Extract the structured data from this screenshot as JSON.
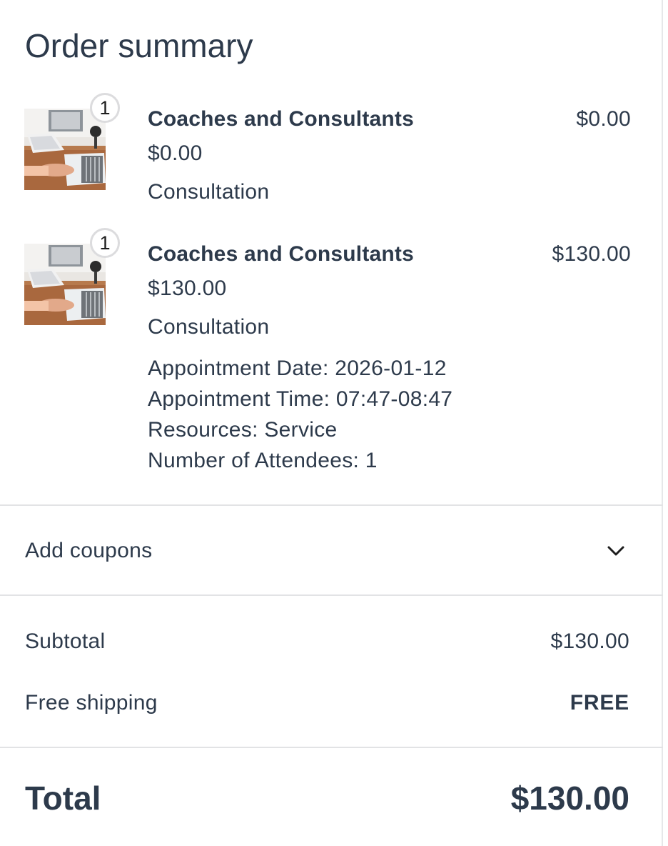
{
  "order_summary": {
    "title": "Order summary",
    "items": [
      {
        "quantity": "1",
        "name": "Coaches and Consultants",
        "unit_price": "$0.00",
        "description": "Consultation",
        "line_price": "$0.00",
        "meta": []
      },
      {
        "quantity": "1",
        "name": "Coaches and Consultants",
        "unit_price": "$130.00",
        "description": "Consultation",
        "line_price": "$130.00",
        "meta": [
          "Appointment Date: 2026-01-12",
          "Appointment Time: 07:47-08:47",
          "Resources: Service",
          "Number of Attendees: 1"
        ]
      }
    ],
    "coupons": {
      "label": "Add coupons",
      "icon": "chevron-down-icon"
    },
    "totals": {
      "subtotal_label": "Subtotal",
      "subtotal_value": "$130.00",
      "shipping_label": "Free shipping",
      "shipping_value": "FREE",
      "total_label": "Total",
      "total_value": "$130.00"
    }
  }
}
